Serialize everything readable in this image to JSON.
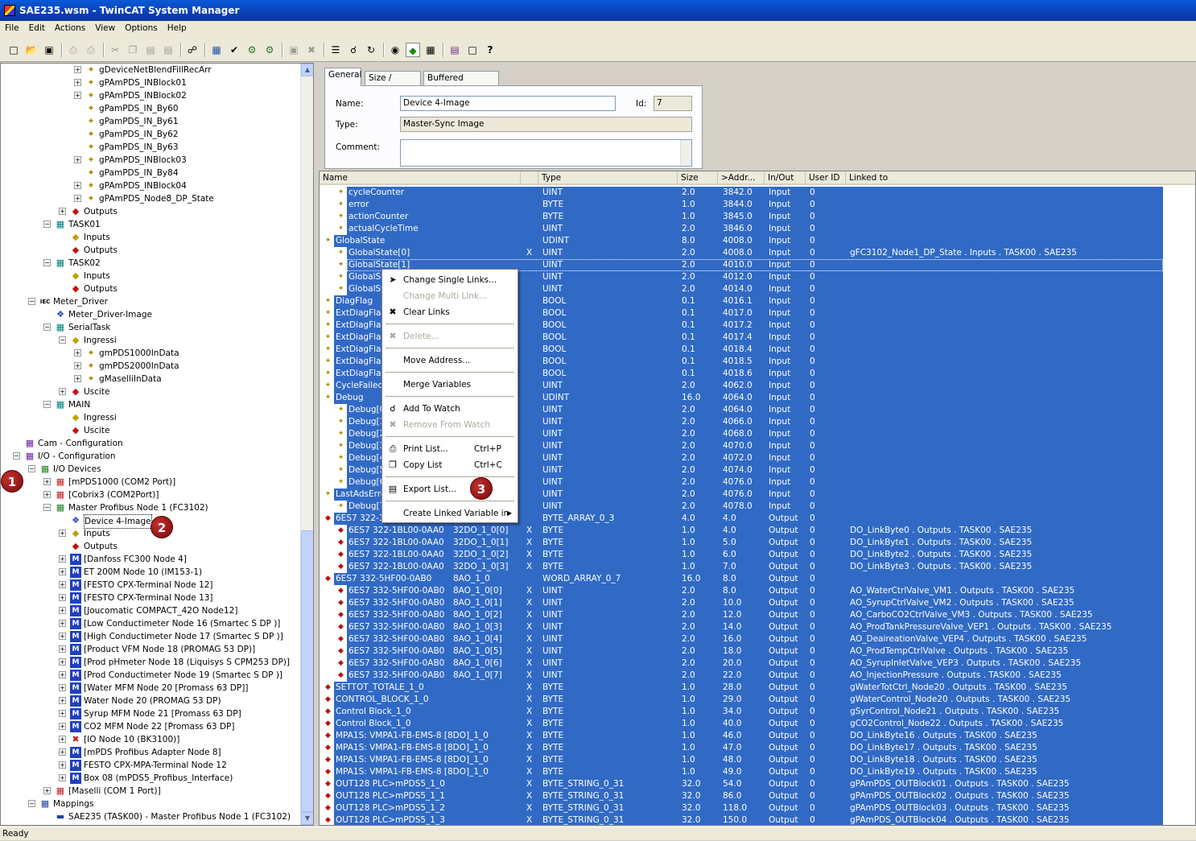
{
  "window_title": "SAE235.wsm - TwinCAT System Manager",
  "menu": [
    "File",
    "Edit",
    "Actions",
    "View",
    "Options",
    "Help"
  ],
  "status_text": "Ready",
  "tree": [
    {
      "label": "gDeviceNetBlendFillRecArr",
      "indent": 5,
      "exp": "+",
      "icon": "var"
    },
    {
      "label": "gPAmPDS_INBlock01",
      "indent": 5,
      "exp": "+",
      "icon": "var"
    },
    {
      "label": "gPAmPDS_INBlock02",
      "indent": 5,
      "exp": "+",
      "icon": "var"
    },
    {
      "label": "gPamPDS_IN_By60",
      "indent": 5,
      "exp": "",
      "icon": "var"
    },
    {
      "label": "gPamPDS_IN_By61",
      "indent": 5,
      "exp": "",
      "icon": "var"
    },
    {
      "label": "gPamPDS_IN_By62",
      "indent": 5,
      "exp": "",
      "icon": "var"
    },
    {
      "label": "gPamPDS_IN_By63",
      "indent": 5,
      "exp": "",
      "icon": "var"
    },
    {
      "label": "gPAmPDS_INBlock03",
      "indent": 5,
      "exp": "+",
      "icon": "var"
    },
    {
      "label": "gPamPDS_IN_By84",
      "indent": 5,
      "exp": "",
      "icon": "var"
    },
    {
      "label": "gPAmPDS_INBlock04",
      "indent": 5,
      "exp": "+",
      "icon": "var"
    },
    {
      "label": "gPAmPDS_Node8_DP_State",
      "indent": 5,
      "exp": "+",
      "icon": "var"
    },
    {
      "label": "Outputs",
      "indent": 4,
      "exp": "+",
      "icon": "out"
    },
    {
      "label": "TASK01",
      "indent": 3,
      "exp": "-",
      "icon": "task"
    },
    {
      "label": "Inputs",
      "indent": 4,
      "exp": "",
      "icon": "in"
    },
    {
      "label": "Outputs",
      "indent": 4,
      "exp": "",
      "icon": "out"
    },
    {
      "label": "TASK02",
      "indent": 3,
      "exp": "-",
      "icon": "task"
    },
    {
      "label": "Inputs",
      "indent": 4,
      "exp": "",
      "icon": "in"
    },
    {
      "label": "Outputs",
      "indent": 4,
      "exp": "",
      "icon": "out"
    },
    {
      "label": "Meter_Driver",
      "indent": 2,
      "exp": "-",
      "icon": "iec"
    },
    {
      "label": "Meter_Driver-Image",
      "indent": 3,
      "exp": "",
      "icon": "image"
    },
    {
      "label": "SerialTask",
      "indent": 3,
      "exp": "-",
      "icon": "task"
    },
    {
      "label": "Ingressi",
      "indent": 4,
      "exp": "-",
      "icon": "in"
    },
    {
      "label": "gmPDS1000InData",
      "indent": 5,
      "exp": "+",
      "icon": "var"
    },
    {
      "label": "gmPDS2000InData",
      "indent": 5,
      "exp": "+",
      "icon": "var"
    },
    {
      "label": "gMaselliInData",
      "indent": 5,
      "exp": "+",
      "icon": "var"
    },
    {
      "label": "Uscite",
      "indent": 4,
      "exp": "+",
      "icon": "out"
    },
    {
      "label": "MAIN",
      "indent": 3,
      "exp": "-",
      "icon": "task"
    },
    {
      "label": "Ingressi",
      "indent": 4,
      "exp": "",
      "icon": "in"
    },
    {
      "label": "Uscite",
      "indent": 4,
      "exp": "",
      "icon": "out"
    },
    {
      "label": "Cam - Configuration",
      "indent": 1,
      "exp": "",
      "icon": "cam"
    },
    {
      "label": "I/O - Configuration",
      "indent": 1,
      "exp": "-",
      "icon": "io"
    },
    {
      "label": "I/O Devices",
      "indent": 2,
      "exp": "-",
      "icon": "iodev"
    },
    {
      "label": "[mPDS1000 (COM2 Port)]",
      "indent": 3,
      "exp": "+",
      "icon": "dev"
    },
    {
      "label": "[Cobrix3 (COM2Port)]",
      "indent": 3,
      "exp": "+",
      "icon": "dev"
    },
    {
      "label": "Master Profibus Node 1 (FC3102)",
      "indent": 3,
      "exp": "-",
      "icon": "iodev"
    },
    {
      "label": "Device 4-Image",
      "indent": 4,
      "exp": "",
      "icon": "image",
      "selected": true
    },
    {
      "label": "Inputs",
      "indent": 4,
      "exp": "+",
      "icon": "in"
    },
    {
      "label": "Outputs",
      "indent": 4,
      "exp": "",
      "icon": "out"
    },
    {
      "label": "[Danfoss FC300 Node 4]",
      "indent": 4,
      "exp": "+",
      "icon": "box"
    },
    {
      "label": "ET 200M Node 10 (IM153-1)",
      "indent": 4,
      "exp": "+",
      "icon": "box"
    },
    {
      "label": "[FESTO CPX-Terminal Node 12]",
      "indent": 4,
      "exp": "+",
      "icon": "box"
    },
    {
      "label": "[FESTO CPX-Terminal Node 13]",
      "indent": 4,
      "exp": "+",
      "icon": "box"
    },
    {
      "label": "[Joucomatic COMPACT_42O Node12]",
      "indent": 4,
      "exp": "+",
      "icon": "box"
    },
    {
      "label": "[Low Conductimeter Node 16 (Smartec S DP    )]",
      "indent": 4,
      "exp": "+",
      "icon": "box"
    },
    {
      "label": "[High Conductimeter Node 17 (Smartec S DP    )]",
      "indent": 4,
      "exp": "+",
      "icon": "box"
    },
    {
      "label": "[Product VFM Node 18 (PROMAG 53 DP)]",
      "indent": 4,
      "exp": "+",
      "icon": "box"
    },
    {
      "label": "[Prod pHmeter Node 18 (Liquisys S CPM253 DP)]",
      "indent": 4,
      "exp": "+",
      "icon": "box"
    },
    {
      "label": "[Prod Conductimeter Node 19 (Smartec S DP    )]",
      "indent": 4,
      "exp": "+",
      "icon": "box"
    },
    {
      "label": "[Water MFM Node 20 [Promass 63 DP]]",
      "indent": 4,
      "exp": "+",
      "icon": "box"
    },
    {
      "label": "Water Node 20 (PROMAG 53 DP)",
      "indent": 4,
      "exp": "+",
      "icon": "box"
    },
    {
      "label": "Syrup MFM Node 21 [Promass 63 DP]",
      "indent": 4,
      "exp": "+",
      "icon": "box"
    },
    {
      "label": "CO2 MFM Node 22 [Promass 63 DP]",
      "indent": 4,
      "exp": "+",
      "icon": "box"
    },
    {
      "label": "[IO Node 10 (BK3100)]",
      "indent": 4,
      "exp": "+",
      "icon": "boxx"
    },
    {
      "label": "[mPDS Profibus Adapter Node 8]",
      "indent": 4,
      "exp": "+",
      "icon": "box"
    },
    {
      "label": "FESTO CPX-MPA-Terminal Node 12",
      "indent": 4,
      "exp": "+",
      "icon": "box"
    },
    {
      "label": "Box 08 (mPDS5_Profibus_Interface)",
      "indent": 4,
      "exp": "+",
      "icon": "box"
    },
    {
      "label": "[Maselli (COM 1 Port)]",
      "indent": 3,
      "exp": "+",
      "icon": "dev"
    },
    {
      "label": "Mappings",
      "indent": 2,
      "exp": "-",
      "icon": "map"
    },
    {
      "label": "SAE235 (TASK00) - Master Profibus Node 1 (FC3102)",
      "indent": 3,
      "exp": "",
      "icon": "mapitem"
    }
  ],
  "badges": [
    "1",
    "2",
    "3"
  ],
  "props": {
    "tabs": [
      "General",
      "Size / Offset",
      "Buffered Mapping"
    ],
    "name_label": "Name:",
    "name_value": "Device 4-Image",
    "id_label": "Id:",
    "id_value": "7",
    "type_label": "Type:",
    "type_value": "Master-Sync Image",
    "comment_label": "Comment:"
  },
  "columns": [
    "Name",
    "Type",
    "Size",
    ">Addr...",
    "In/Out",
    "User ID",
    "Linked to"
  ],
  "rows": [
    {
      "n": "cycleCounter",
      "t": "UINT",
      "s": "2.0",
      "a": "3842.0",
      "io": "Input",
      "u": "0",
      "l": "",
      "lvl": 1
    },
    {
      "n": "error",
      "t": "BYTE",
      "s": "1.0",
      "a": "3844.0",
      "io": "Input",
      "u": "0",
      "l": "",
      "lvl": 1
    },
    {
      "n": "actionCounter",
      "t": "BYTE",
      "s": "1.0",
      "a": "3845.0",
      "io": "Input",
      "u": "0",
      "l": "",
      "lvl": 1
    },
    {
      "n": "actualCycleTime",
      "t": "UINT",
      "s": "2.0",
      "a": "3846.0",
      "io": "Input",
      "u": "0",
      "l": "",
      "lvl": 1
    },
    {
      "n": "GlobalState",
      "t": "UDINT",
      "s": "8.0",
      "a": "4008.0",
      "io": "Input",
      "u": "0",
      "l": "",
      "lvl": 0
    },
    {
      "n": "GlobalState[0]",
      "x": "X",
      "t": "UINT",
      "s": "2.0",
      "a": "4008.0",
      "io": "Input",
      "u": "0",
      "l": "gFC3102_Node1_DP_State . Inputs . TASK00 . SAE235",
      "lvl": 1
    },
    {
      "n": "GlobalState[1]",
      "t": "UINT",
      "s": "2.0",
      "a": "4010.0",
      "io": "Input",
      "u": "0",
      "l": "",
      "lvl": 1,
      "focus": true
    },
    {
      "n": "GlobalState[2]",
      "t": "UINT",
      "s": "2.0",
      "a": "4012.0",
      "io": "Input",
      "u": "0",
      "l": "",
      "lvl": 1
    },
    {
      "n": "GlobalState[3]",
      "t": "UINT",
      "s": "2.0",
      "a": "4014.0",
      "io": "Input",
      "u": "0",
      "l": "",
      "lvl": 1
    },
    {
      "n": "DiagFlag",
      "t": "BOOL",
      "s": "0.1",
      "a": "4016.1",
      "io": "Input",
      "u": "0",
      "l": "",
      "lvl": 0
    },
    {
      "n": "ExtDiagFlag",
      "t": "BOOL",
      "s": "0.1",
      "a": "4017.0",
      "io": "Input",
      "u": "0",
      "l": "",
      "lvl": 0
    },
    {
      "n": "ExtDiagFlag",
      "t": "BOOL",
      "s": "0.1",
      "a": "4017.2",
      "io": "Input",
      "u": "0",
      "l": "",
      "lvl": 0
    },
    {
      "n": "ExtDiagFlag",
      "t": "BOOL",
      "s": "0.1",
      "a": "4017.4",
      "io": "Input",
      "u": "0",
      "l": "",
      "lvl": 0
    },
    {
      "n": "ExtDiagFlag",
      "t": "BOOL",
      "s": "0.1",
      "a": "4018.4",
      "io": "Input",
      "u": "0",
      "l": "",
      "lvl": 0
    },
    {
      "n": "ExtDiagFlag",
      "t": "BOOL",
      "s": "0.1",
      "a": "4018.5",
      "io": "Input",
      "u": "0",
      "l": "",
      "lvl": 0
    },
    {
      "n": "ExtDiagFlag",
      "t": "BOOL",
      "s": "0.1",
      "a": "4018.6",
      "io": "Input",
      "u": "0",
      "l": "",
      "lvl": 0
    },
    {
      "n": "CycleFailedCounter",
      "t": "UINT",
      "s": "2.0",
      "a": "4062.0",
      "io": "Input",
      "u": "0",
      "l": "",
      "lvl": 0
    },
    {
      "n": "Debug",
      "t": "UDINT",
      "s": "16.0",
      "a": "4064.0",
      "io": "Input",
      "u": "0",
      "l": "",
      "lvl": 0
    },
    {
      "n": "Debug[0]",
      "t": "UINT",
      "s": "2.0",
      "a": "4064.0",
      "io": "Input",
      "u": "0",
      "l": "",
      "lvl": 1
    },
    {
      "n": "Debug[1]",
      "t": "UINT",
      "s": "2.0",
      "a": "4066.0",
      "io": "Input",
      "u": "0",
      "l": "",
      "lvl": 1
    },
    {
      "n": "Debug[2]",
      "t": "UINT",
      "s": "2.0",
      "a": "4068.0",
      "io": "Input",
      "u": "0",
      "l": "",
      "lvl": 1
    },
    {
      "n": "Debug[3]",
      "t": "UINT",
      "s": "2.0",
      "a": "4070.0",
      "io": "Input",
      "u": "0",
      "l": "",
      "lvl": 1
    },
    {
      "n": "Debug[4]",
      "t": "UINT",
      "s": "2.0",
      "a": "4072.0",
      "io": "Input",
      "u": "0",
      "l": "",
      "lvl": 1
    },
    {
      "n": "Debug[5]",
      "t": "UINT",
      "s": "2.0",
      "a": "4074.0",
      "io": "Input",
      "u": "0",
      "l": "",
      "lvl": 1
    },
    {
      "n": "Debug[6]",
      "t": "UINT",
      "s": "2.0",
      "a": "4076.0",
      "io": "Input",
      "u": "0",
      "l": "",
      "lvl": 1
    },
    {
      "n": "LastAdsErrorCode",
      "t": "UINT",
      "s": "2.0",
      "a": "4076.0",
      "io": "Input",
      "u": "0",
      "l": "",
      "lvl": 0
    },
    {
      "n": "Debug[7]",
      "t": "UINT",
      "s": "2.0",
      "a": "4078.0",
      "io": "Input",
      "u": "0",
      "l": "",
      "lvl": 1
    },
    {
      "n": "6ES7 322-1BL00-0AA0",
      "t": "BYTE_ARRAY_0_3",
      "s": "4.0",
      "a": "4.0",
      "io": "Output",
      "u": "0",
      "l": "",
      "lvl": 0
    },
    {
      "n": "6ES7 322-1BL00-0AA0",
      "sub": "32DO_1_0[0]",
      "x": "X",
      "t": "BYTE",
      "s": "1.0",
      "a": "4.0",
      "io": "Output",
      "u": "0",
      "l": "DO_LinkByte0 . Outputs . TASK00 . SAE235",
      "lvl": 1
    },
    {
      "n": "6ES7 322-1BL00-0AA0",
      "sub": "32DO_1_0[1]",
      "x": "X",
      "t": "BYTE",
      "s": "1.0",
      "a": "5.0",
      "io": "Output",
      "u": "0",
      "l": "DO_LinkByte1 . Outputs . TASK00 . SAE235",
      "lvl": 1
    },
    {
      "n": "6ES7 322-1BL00-0AA0",
      "sub": "32DO_1_0[2]",
      "x": "X",
      "t": "BYTE",
      "s": "1.0",
      "a": "6.0",
      "io": "Output",
      "u": "0",
      "l": "DO_LinkByte2 . Outputs . TASK00 . SAE235",
      "lvl": 1
    },
    {
      "n": "6ES7 322-1BL00-0AA0",
      "sub": "32DO_1_0[3]",
      "x": "X",
      "t": "BYTE",
      "s": "1.0",
      "a": "7.0",
      "io": "Output",
      "u": "0",
      "l": "DO_LinkByte3 . Outputs . TASK00 . SAE235",
      "lvl": 1
    },
    {
      "n": "6ES7 332-5HF00-0AB0",
      "sub": "8AO_1_0",
      "t": "WORD_ARRAY_0_7",
      "s": "16.0",
      "a": "8.0",
      "io": "Output",
      "u": "0",
      "l": "",
      "lvl": 0
    },
    {
      "n": "6ES7 332-5HF00-0AB0",
      "sub": "8AO_1_0[0]",
      "x": "X",
      "t": "UINT",
      "s": "2.0",
      "a": "8.0",
      "io": "Output",
      "u": "0",
      "l": "AO_WaterCtrlValve_VM1 . Outputs . TASK00 . SAE235",
      "lvl": 1
    },
    {
      "n": "6ES7 332-5HF00-0AB0",
      "sub": "8AO_1_0[1]",
      "x": "X",
      "t": "UINT",
      "s": "2.0",
      "a": "10.0",
      "io": "Output",
      "u": "0",
      "l": "AO_SyrupCtrlValve_VM2 . Outputs . TASK00 . SAE235",
      "lvl": 1
    },
    {
      "n": "6ES7 332-5HF00-0AB0",
      "sub": "8AO_1_0[2]",
      "x": "X",
      "t": "UINT",
      "s": "2.0",
      "a": "12.0",
      "io": "Output",
      "u": "0",
      "l": "AO_CarboCO2CtrlValve_VM3 . Outputs . TASK00 . SAE235",
      "lvl": 1
    },
    {
      "n": "6ES7 332-5HF00-0AB0",
      "sub": "8AO_1_0[3]",
      "x": "X",
      "t": "UINT",
      "s": "2.0",
      "a": "14.0",
      "io": "Output",
      "u": "0",
      "l": "AO_ProdTankPressureValve_VEP1 . Outputs . TASK00 . SAE235",
      "lvl": 1
    },
    {
      "n": "6ES7 332-5HF00-0AB0",
      "sub": "8AO_1_0[4]",
      "x": "X",
      "t": "UINT",
      "s": "2.0",
      "a": "16.0",
      "io": "Output",
      "u": "0",
      "l": "AO_DeaireationValve_VEP4 . Outputs . TASK00 . SAE235",
      "lvl": 1
    },
    {
      "n": "6ES7 332-5HF00-0AB0",
      "sub": "8AO_1_0[5]",
      "x": "X",
      "t": "UINT",
      "s": "2.0",
      "a": "18.0",
      "io": "Output",
      "u": "0",
      "l": "AO_ProdTempCtrlValve . Outputs . TASK00 . SAE235",
      "lvl": 1
    },
    {
      "n": "6ES7 332-5HF00-0AB0",
      "sub": "8AO_1_0[6]",
      "x": "X",
      "t": "UINT",
      "s": "2.0",
      "a": "20.0",
      "io": "Output",
      "u": "0",
      "l": "AO_SyrupInletValve_VEP3 . Outputs . TASK00 . SAE235",
      "lvl": 1
    },
    {
      "n": "6ES7 332-5HF00-0AB0",
      "sub": "8AO_1_0[7]",
      "x": "X",
      "t": "UINT",
      "s": "2.0",
      "a": "22.0",
      "io": "Output",
      "u": "0",
      "l": "AO_InjectionPressure . Outputs . TASK00 . SAE235",
      "lvl": 1
    },
    {
      "n": "SETTOT_TOTALE_1_0",
      "x": "X",
      "t": "BYTE",
      "s": "1.0",
      "a": "28.0",
      "io": "Output",
      "u": "0",
      "l": "gWaterTotCtrl_Node20 . Outputs . TASK00 . SAE235",
      "lvl": 0
    },
    {
      "n": "CONTROL_BLOCK_1_0",
      "x": "X",
      "t": "BYTE",
      "s": "1.0",
      "a": "29.0",
      "io": "Output",
      "u": "0",
      "l": "gWaterControl_Node20 . Outputs . TASK00 . SAE235",
      "lvl": 0
    },
    {
      "n": "Control Block_1_0",
      "x": "X",
      "t": "BYTE",
      "s": "1.0",
      "a": "34.0",
      "io": "Output",
      "u": "0",
      "l": "gSyrControl_Node21 . Outputs . TASK00 . SAE235",
      "lvl": 0
    },
    {
      "n": "Control Block_1_0",
      "x": "X",
      "t": "BYTE",
      "s": "1.0",
      "a": "40.0",
      "io": "Output",
      "u": "0",
      "l": "gCO2Control_Node22 . Outputs . TASK00 . SAE235",
      "lvl": 0
    },
    {
      "n": "MPA1S: VMPA1-FB-EMS-8 [8DO]_1_0",
      "x": "X",
      "t": "BYTE",
      "s": "1.0",
      "a": "46.0",
      "io": "Output",
      "u": "0",
      "l": "DO_LinkByte16 . Outputs . TASK00 . SAE235",
      "lvl": 0
    },
    {
      "n": "MPA1S: VMPA1-FB-EMS-8 [8DO]_1_0",
      "x": "X",
      "t": "BYTE",
      "s": "1.0",
      "a": "47.0",
      "io": "Output",
      "u": "0",
      "l": "DO_LinkByte17 . Outputs . TASK00 . SAE235",
      "lvl": 0
    },
    {
      "n": "MPA1S: VMPA1-FB-EMS-8 [8DO]_1_0",
      "x": "X",
      "t": "BYTE",
      "s": "1.0",
      "a": "48.0",
      "io": "Output",
      "u": "0",
      "l": "DO_LinkByte18 . Outputs . TASK00 . SAE235",
      "lvl": 0
    },
    {
      "n": "MPA1S: VMPA1-FB-EMS-8 [8DO]_1_0",
      "x": "X",
      "t": "BYTE",
      "s": "1.0",
      "a": "49.0",
      "io": "Output",
      "u": "0",
      "l": "DO_LinkByte19 . Outputs . TASK00 . SAE235",
      "lvl": 0
    },
    {
      "n": "OUT128 PLC>mPDS5_1_0",
      "x": "X",
      "t": "BYTE_STRING_0_31",
      "s": "32.0",
      "a": "54.0",
      "io": "Output",
      "u": "0",
      "l": "gPAmPDS_OUTBlock01 . Outputs . TASK00 . SAE235",
      "lvl": 0
    },
    {
      "n": "OUT128 PLC>mPDS5_1_1",
      "x": "X",
      "t": "BYTE_STRING_0_31",
      "s": "32.0",
      "a": "86.0",
      "io": "Output",
      "u": "0",
      "l": "gPAmPDS_OUTBlock02 . Outputs . TASK00 . SAE235",
      "lvl": 0
    },
    {
      "n": "OUT128 PLC>mPDS5_1_2",
      "x": "X",
      "t": "BYTE_STRING_0_31",
      "s": "32.0",
      "a": "118.0",
      "io": "Output",
      "u": "0",
      "l": "gPAmPDS_OUTBlock03 . Outputs . TASK00 . SAE235",
      "lvl": 0
    },
    {
      "n": "OUT128 PLC>mPDS5_1_3",
      "x": "X",
      "t": "BYTE_STRING_0_31",
      "s": "32.0",
      "a": "150.0",
      "io": "Output",
      "u": "0",
      "l": "gPAmPDS_OUTBlock04 . Outputs . TASK00 . SAE235",
      "lvl": 0
    }
  ],
  "context_menu": [
    {
      "label": "Change Single Links...",
      "key": "",
      "dis": false,
      "icon": "link-icon"
    },
    {
      "label": "Change Multi Link...",
      "key": "",
      "dis": true,
      "icon": ""
    },
    {
      "label": "Clear Links",
      "key": "",
      "dis": false,
      "icon": "clear-icon"
    },
    {
      "sep": true
    },
    {
      "label": "Delete...",
      "key": "",
      "dis": true,
      "icon": "delete-icon"
    },
    {
      "sep": true
    },
    {
      "label": "Move Address...",
      "key": "",
      "dis": false,
      "icon": ""
    },
    {
      "sep": true
    },
    {
      "label": "Merge Variables",
      "key": "",
      "dis": false,
      "icon": ""
    },
    {
      "sep": true
    },
    {
      "label": "Add To Watch",
      "key": "",
      "dis": false,
      "icon": "watch-icon"
    },
    {
      "label": "Remove From Watch",
      "key": "",
      "dis": true,
      "icon": "unwatch-icon"
    },
    {
      "sep": true
    },
    {
      "label": "Print List...",
      "key": "Ctrl+P",
      "dis": false,
      "icon": "print-icon"
    },
    {
      "label": "Copy List",
      "key": "Ctrl+C",
      "dis": false,
      "icon": "copy-icon"
    },
    {
      "sep": true
    },
    {
      "label": "Export List...",
      "key": "",
      "dis": false,
      "icon": "export-icon"
    },
    {
      "sep": true
    },
    {
      "label": "Create Linked Variable in",
      "key": "",
      "dis": false,
      "icon": "",
      "submenu": true
    }
  ]
}
